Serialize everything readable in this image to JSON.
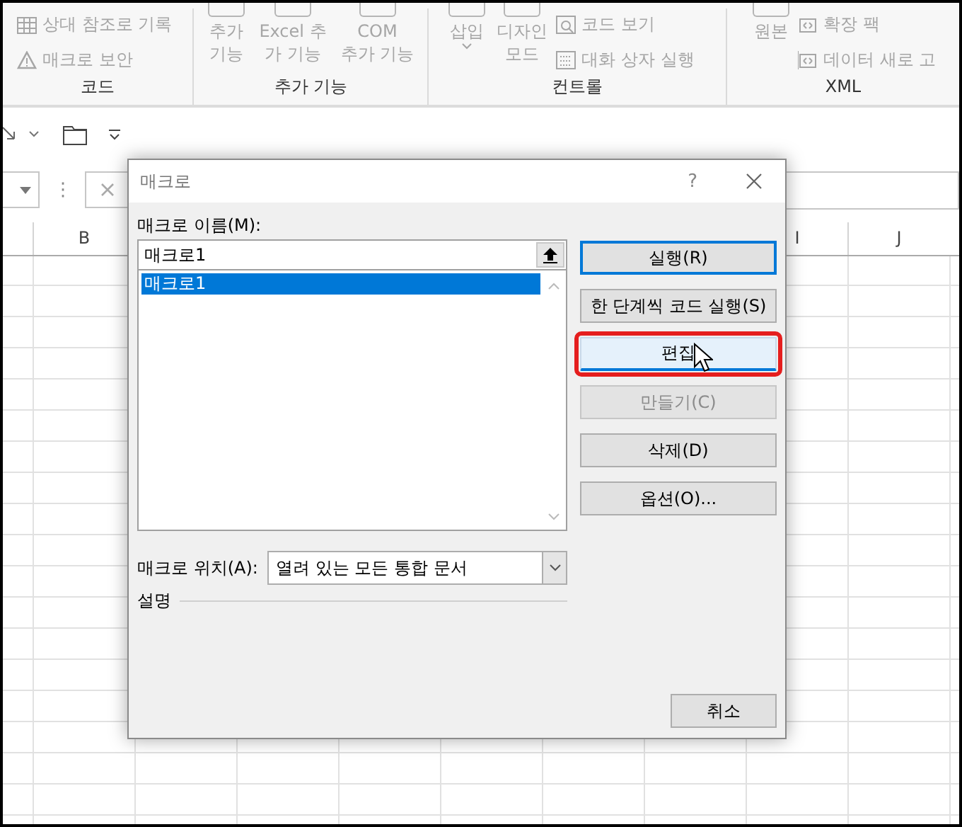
{
  "ribbon": {
    "groups": [
      {
        "label": "코드",
        "items": [
          {
            "kind": "small",
            "label": "상대 참조로 기록"
          },
          {
            "kind": "small",
            "label": "매크로 보안"
          }
        ]
      },
      {
        "label": "추가 기능",
        "items": [
          {
            "kind": "large",
            "lines": [
              "추가",
              "기능"
            ]
          },
          {
            "kind": "large",
            "lines": [
              "Excel 추",
              "가 기능"
            ]
          },
          {
            "kind": "large",
            "lines": [
              "COM",
              "추가 기능"
            ]
          }
        ]
      },
      {
        "label": "컨트롤",
        "items": [
          {
            "kind": "dropdown",
            "lines": [
              "삽입"
            ]
          },
          {
            "kind": "large",
            "lines": [
              "디자인",
              "모드"
            ]
          },
          {
            "kind": "small",
            "label": "코드 보기"
          },
          {
            "kind": "small",
            "label": "대화 상자 실행"
          }
        ]
      },
      {
        "label": "XML",
        "items": [
          {
            "kind": "large",
            "lines": [
              "원본"
            ]
          },
          {
            "kind": "small",
            "label": "확장 팩"
          },
          {
            "kind": "small",
            "label": "데이터 새로 고"
          }
        ]
      }
    ]
  },
  "formula_bar": {
    "separator": "⋮"
  },
  "sheet": {
    "columns_left": [
      "B"
    ],
    "columns_right": [
      "I",
      "J"
    ]
  },
  "dialog": {
    "title": "매크로",
    "help": "?",
    "name_label": "매크로 이름(M):",
    "name_value": "매크로1",
    "macros": [
      {
        "label": "매크로1",
        "selected": true
      }
    ],
    "location_label": "매크로 위치(A):",
    "location_value": "열려 있는 모든 통합 문서",
    "description_label": "설명",
    "buttons": [
      {
        "label": "실행(R)",
        "default": true,
        "hover": false,
        "disabled": false,
        "highlighted": false
      },
      {
        "label": "한 단계씩 코드 실행(S)",
        "default": false,
        "hover": false,
        "disabled": false,
        "highlighted": false
      },
      {
        "label": "편집",
        "default": false,
        "hover": true,
        "disabled": false,
        "highlighted": true
      },
      {
        "label": "만들기(C)",
        "default": false,
        "hover": false,
        "disabled": true,
        "highlighted": false
      },
      {
        "label": "삭제(D)",
        "default": false,
        "hover": false,
        "disabled": false,
        "highlighted": false
      },
      {
        "label": "옵션(O)...",
        "default": false,
        "hover": false,
        "disabled": false,
        "highlighted": false
      }
    ],
    "cancel": "취소"
  }
}
